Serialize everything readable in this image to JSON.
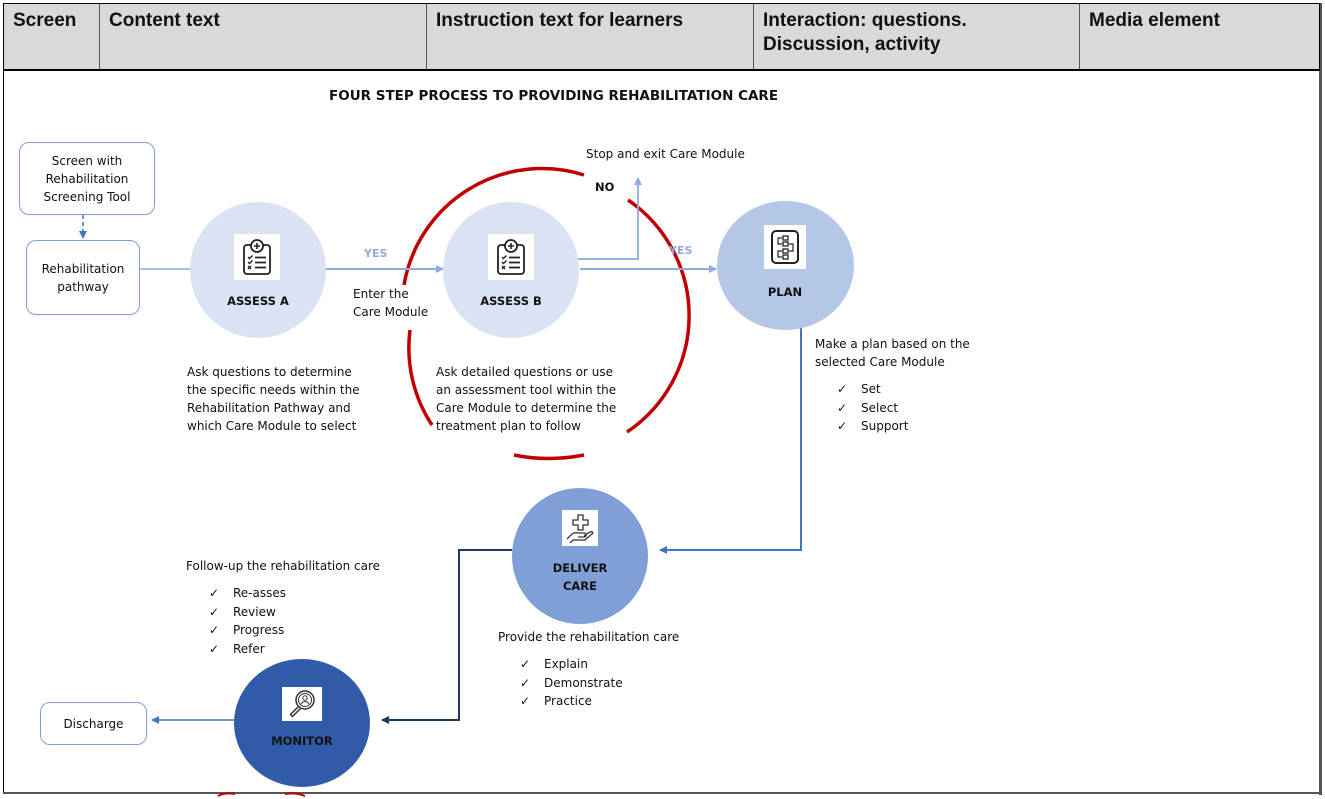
{
  "table_header": {
    "columns": [
      "Screen",
      "Content text",
      "Instruction text for learners",
      "Interaction: questions. Discussion, activity",
      "Media element"
    ]
  },
  "diagram": {
    "title": "FOUR STEP PROCESS TO PROVIDING REHABILITATION CARE",
    "boxes": {
      "screen_tool": "Screen with Rehabilitation Screening Tool",
      "pathway": "Rehabilitation pathway",
      "discharge": "Discharge"
    },
    "nodes": {
      "assess_a": {
        "label": "ASSESS A",
        "icon": "clipboard-checklist-icon",
        "color": "#dae3f3"
      },
      "assess_b": {
        "label": "ASSESS B",
        "icon": "clipboard-checklist-icon",
        "color": "#dae3f3"
      },
      "plan": {
        "label": "PLAN",
        "icon": "flowchart-document-icon",
        "color": "#b4c7e7"
      },
      "deliver": {
        "label_line1": "DELIVER",
        "label_line2": "CARE",
        "icon": "hand-medical-cross-icon",
        "color": "#7f9fd6"
      },
      "monitor": {
        "label": "MONITOR",
        "icon": "magnifier-person-icon",
        "color": "#2f5ba8"
      }
    },
    "edge_labels": {
      "yes_a_b": "YES",
      "yes_b_plan": "YES",
      "no": "NO",
      "stop_exit": "Stop and exit Care Module",
      "enter_line1": "Enter the",
      "enter_line2": "Care Module"
    },
    "descriptions": {
      "assess_a": [
        "Ask questions to determine",
        "the specific needs within the",
        "Rehabilitation Pathway and",
        "which Care Module to select"
      ],
      "assess_b": [
        "Ask detailed questions or use",
        "an assessment tool within the",
        "Care Module to determine the",
        "treatment plan to follow"
      ],
      "plan": {
        "lines": [
          "Make a plan based on the",
          "selected Care Module"
        ],
        "checks": [
          "Set",
          "Select",
          "Support"
        ]
      },
      "deliver": {
        "text": "Provide the rehabilitation care",
        "checks": [
          "Explain",
          "Demonstrate",
          "Practice"
        ]
      },
      "monitor": {
        "text": "Follow-up the rehabilitation care",
        "checks": [
          "Re-asses",
          "Review",
          "Progress",
          "Refer"
        ]
      }
    },
    "check_glyph": "✓",
    "colors": {
      "red_cycle": "#c00000",
      "light_arrow": "#8faadc",
      "mid_arrow": "#4472c4",
      "dark_arrow": "#203864"
    }
  }
}
